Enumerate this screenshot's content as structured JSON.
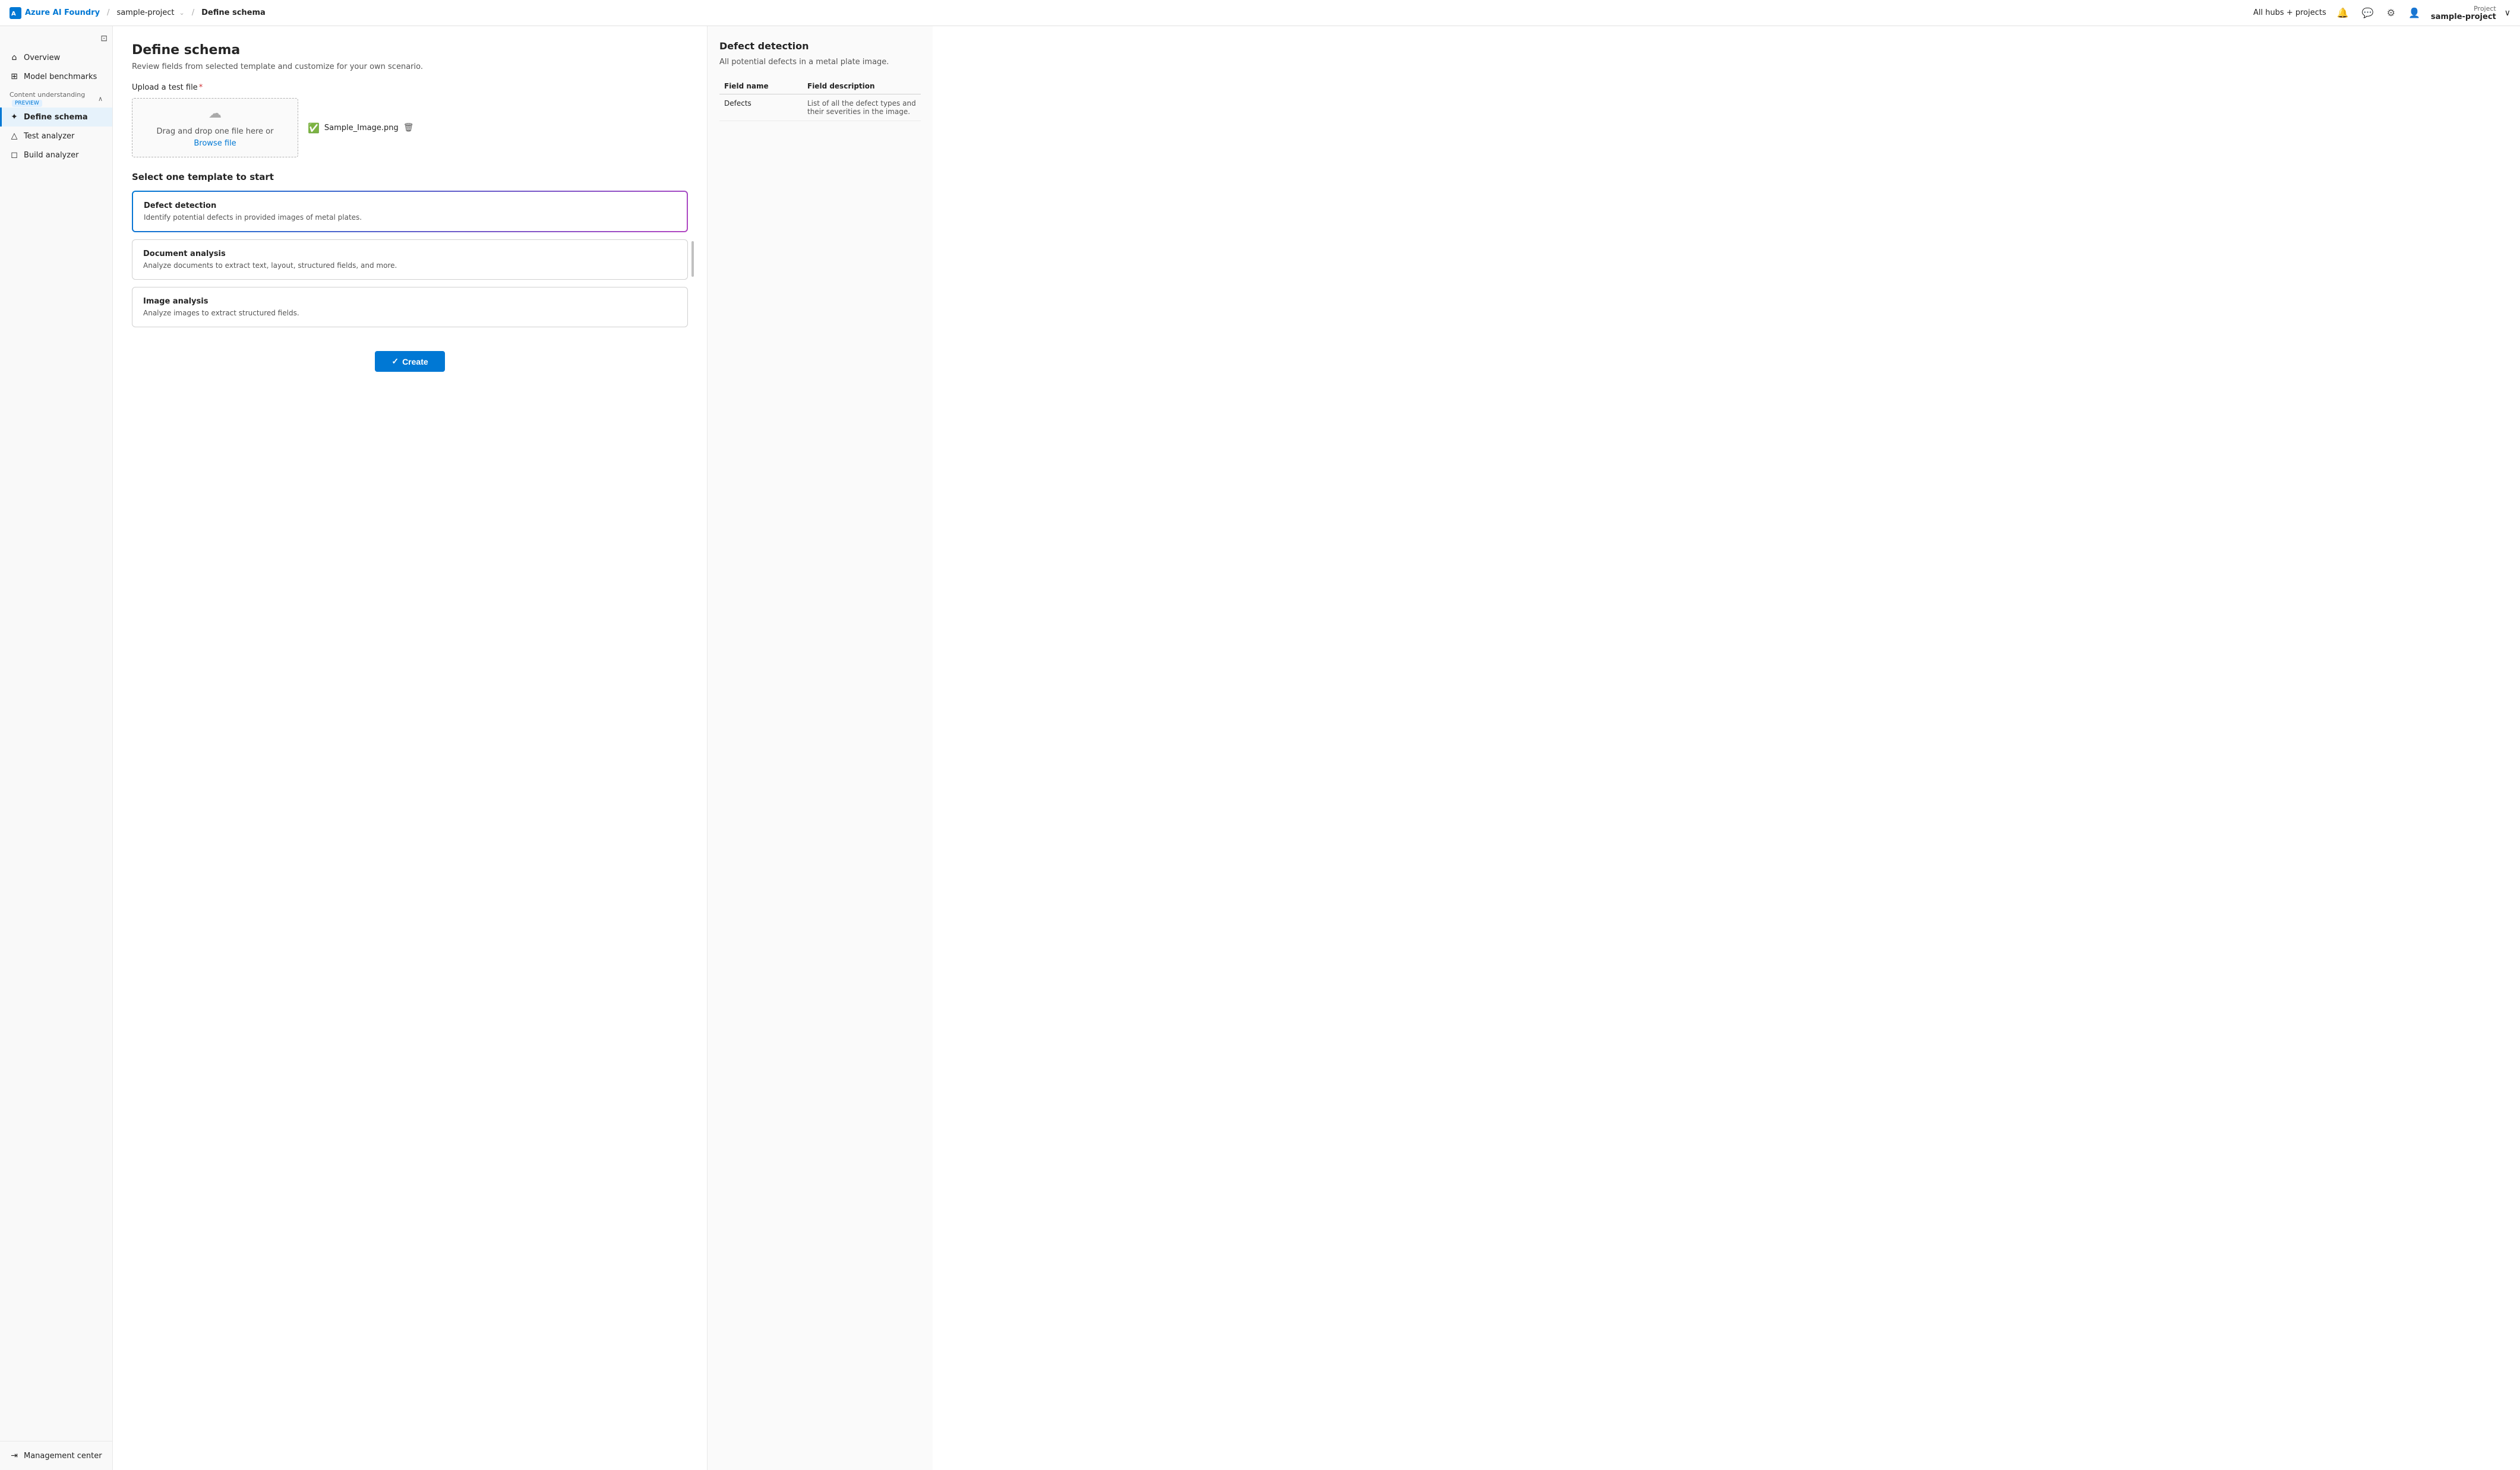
{
  "topnav": {
    "brand": "Azure AI Foundry",
    "sep1": "/",
    "project_link": "sample-project",
    "sep2": "/",
    "current_page": "Define schema",
    "hubs_label": "All hubs + projects",
    "project_section": {
      "label": "Project",
      "name": "sample-project"
    }
  },
  "sidebar": {
    "toggle_icon": "⊡",
    "nav_items": [
      {
        "id": "overview",
        "label": "Overview",
        "icon": "⌂"
      },
      {
        "id": "model-benchmarks",
        "label": "Model benchmarks",
        "icon": "⊞"
      }
    ],
    "section": {
      "label": "Content understanding",
      "badge": "PREVIEW",
      "chevron": "∧"
    },
    "section_items": [
      {
        "id": "define-schema",
        "label": "Define schema",
        "icon": "✦",
        "active": true
      },
      {
        "id": "test-analyzer",
        "label": "Test analyzer",
        "icon": "⬡"
      },
      {
        "id": "build-analyzer",
        "label": "Build analyzer",
        "icon": "⬡"
      }
    ],
    "bottom_item": {
      "id": "management-center",
      "label": "Management center",
      "icon": "→"
    }
  },
  "page": {
    "title": "Define schema",
    "subtitle": "Review fields from selected template and customize for your own scenario.",
    "upload_section": {
      "label": "Upload a test file",
      "required": true,
      "dropzone_line1": "Drag and drop one file here or",
      "dropzone_line2": "Browse file",
      "uploaded_file": "Sample_Image.png"
    },
    "templates_section": {
      "title": "Select one template to start",
      "templates": [
        {
          "id": "defect-detection",
          "title": "Defect detection",
          "description": "Identify potential defects in provided images of metal plates.",
          "selected": true
        },
        {
          "id": "document-analysis",
          "title": "Document analysis",
          "description": "Analyze documents to extract text, layout, structured fields, and more.",
          "selected": false
        },
        {
          "id": "image-analysis",
          "title": "Image analysis",
          "description": "Analyze images to extract structured fields.",
          "selected": false
        }
      ]
    },
    "create_button": "Create"
  },
  "right_panel": {
    "title": "Defect detection",
    "description": "All potential defects in a metal plate image.",
    "table": {
      "headers": [
        "Field name",
        "Field description"
      ],
      "rows": [
        {
          "field_name": "Defects",
          "field_description": "List of all the defect types and their severities in the image."
        }
      ]
    }
  }
}
